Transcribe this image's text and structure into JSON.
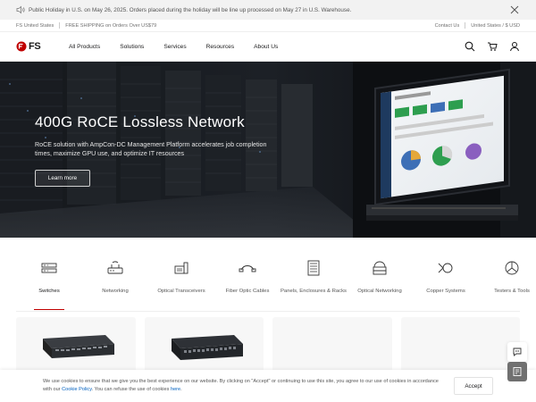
{
  "notice": {
    "text": "Public Holiday in U.S. on May 26, 2025. Orders placed during the holiday will be line up processed on May 27 in U.S. Warehouse."
  },
  "util": {
    "location": "FS United States",
    "shipping": "FREE SHIPPING on Orders Over US$79",
    "contact": "Contact Us",
    "region": "United States / $ USD"
  },
  "nav": {
    "logo_text": "FS",
    "items": [
      "All Products",
      "Solutions",
      "Services",
      "Resources",
      "About Us"
    ]
  },
  "hero": {
    "title": "400G RoCE Lossless Network",
    "description": "RoCE solution with AmpCon-DC Management Platform accelerates job completion times, maximize GPU use, and optimize IT resources",
    "cta": "Learn more"
  },
  "categories": [
    {
      "label": "Switches",
      "icon": "switch-icon",
      "active": true
    },
    {
      "label": "Networking",
      "icon": "router-icon",
      "active": false
    },
    {
      "label": "Optical Transceivers",
      "icon": "transceiver-icon",
      "active": false
    },
    {
      "label": "Fiber Optic Cables",
      "icon": "fiber-cable-icon",
      "active": false
    },
    {
      "label": "Panels, Enclosures & Racks",
      "icon": "rack-icon",
      "active": false
    },
    {
      "label": "Optical Networking",
      "icon": "optical-network-icon",
      "active": false
    },
    {
      "label": "Copper Systems",
      "icon": "copper-icon",
      "active": false
    },
    {
      "label": "Testers & Tools",
      "icon": "tester-icon",
      "active": false
    }
  ],
  "cookie": {
    "text_before": "We use cookies to ensure that we give you the best experience on our website. By clicking on \"Accept\" or continuing to use this site, you agree to our use of cookies in accordance with our ",
    "policy_link": "Cookie Policy",
    "text_middle": ". You can refuse the use of cookies ",
    "here_link": "here",
    "text_after": ".",
    "accept": "Accept"
  },
  "colors": {
    "brand_red": "#c00000",
    "link_blue": "#0060bf"
  }
}
